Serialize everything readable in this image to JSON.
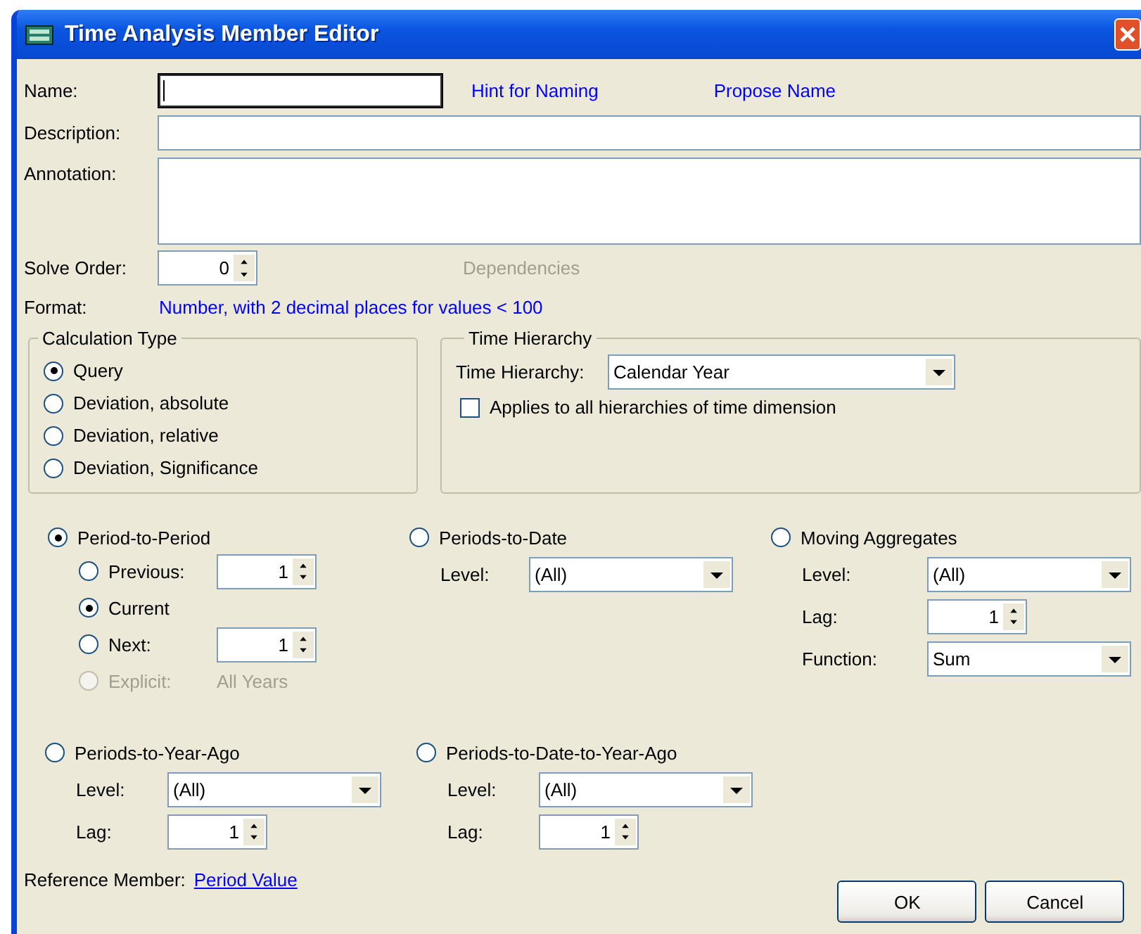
{
  "window": {
    "title": "Time Analysis Member Editor"
  },
  "name": {
    "label": "Name:",
    "focused": true
  },
  "hint_link": "Hint for Naming",
  "propose_link": "Propose Name",
  "description": {
    "label": "Description:"
  },
  "annotation": {
    "label": "Annotation:"
  },
  "solve_order": {
    "label": "Solve Order:",
    "value": "0"
  },
  "dependencies": {
    "label": "Dependencies",
    "disabled": true
  },
  "format": {
    "label": "Format:",
    "value": "Number, with 2 decimal places for values < 100"
  },
  "calculation_type": {
    "title": "Calculation Type",
    "options": [
      {
        "label": "Query",
        "selected": true
      },
      {
        "label": "Deviation, absolute",
        "selected": false
      },
      {
        "label": "Deviation, relative",
        "selected": false
      },
      {
        "label": "Deviation, Significance",
        "selected": false
      }
    ]
  },
  "time_hierarchy": {
    "title": "Time Hierarchy",
    "label": "Time Hierarchy:",
    "value": "Calendar Year",
    "applies_all": {
      "label": "Applies to all hierarchies of time dimension",
      "checked": false
    }
  },
  "modes": [
    {
      "label": "Period-to-Period",
      "selected": true,
      "options": [
        {
          "kind": "spinner",
          "label": "Previous:",
          "value": "1",
          "selected": false,
          "disabled": false
        },
        {
          "kind": "plain",
          "label": "Current",
          "selected": true,
          "disabled": false
        },
        {
          "kind": "spinner",
          "label": "Next:",
          "value": "1",
          "selected": false,
          "disabled": false
        },
        {
          "kind": "text",
          "label": "Explicit:",
          "value": "All Years",
          "selected": false,
          "disabled": true
        }
      ]
    },
    {
      "label": "Periods-to-Date",
      "selected": false,
      "fields": [
        {
          "kind": "dropdown",
          "label": "Level:",
          "value": "(All)"
        }
      ]
    },
    {
      "label": "Moving Aggregates",
      "selected": false,
      "fields": [
        {
          "kind": "dropdown",
          "label": "Level:",
          "value": "(All)"
        },
        {
          "kind": "spinner",
          "label": "Lag:",
          "value": "1"
        },
        {
          "kind": "dropdown",
          "label": "Function:",
          "value": "Sum"
        }
      ]
    },
    {
      "label": "Periods-to-Year-Ago",
      "selected": false,
      "fields": [
        {
          "kind": "dropdown",
          "label": "Level:",
          "value": "(All)"
        },
        {
          "kind": "spinner",
          "label": "Lag:",
          "value": "1"
        }
      ]
    },
    {
      "label": "Periods-to-Date-to-Year-Ago",
      "selected": false,
      "fields": [
        {
          "kind": "dropdown",
          "label": "Level:",
          "value": "(All)"
        },
        {
          "kind": "spinner",
          "label": "Lag:",
          "value": "1"
        }
      ]
    }
  ],
  "reference_member": {
    "label": "Reference Member:",
    "link": "Period Value"
  },
  "buttons": [
    "OK",
    "Cancel"
  ]
}
